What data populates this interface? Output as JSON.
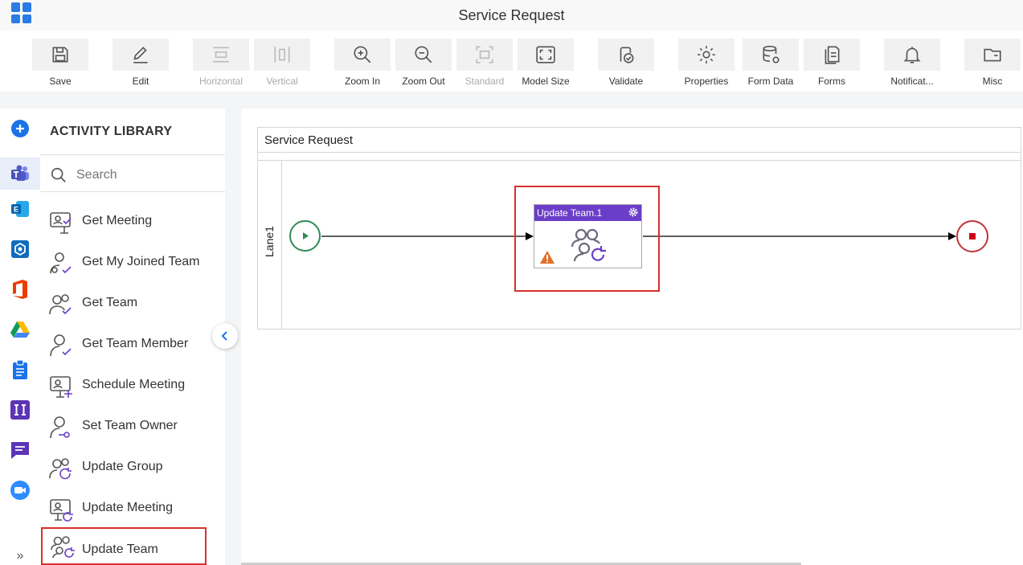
{
  "app": {
    "title": "Service Request"
  },
  "toolbar": {
    "items": [
      {
        "label": "Save",
        "icon": "save-icon",
        "enabled": true
      },
      {
        "label": "Edit",
        "icon": "edit-icon",
        "enabled": true
      },
      {
        "label": "Horizontal",
        "icon": "horizontal-icon",
        "enabled": false
      },
      {
        "label": "Vertical",
        "icon": "vertical-icon",
        "enabled": false
      },
      {
        "label": "Zoom In",
        "icon": "zoom-in-icon",
        "enabled": true
      },
      {
        "label": "Zoom Out",
        "icon": "zoom-out-icon",
        "enabled": true
      },
      {
        "label": "Standard",
        "icon": "standard-icon",
        "enabled": false
      },
      {
        "label": "Model Size",
        "icon": "model-size-icon",
        "enabled": true
      },
      {
        "label": "Validate",
        "icon": "validate-icon",
        "enabled": true
      },
      {
        "label": "Properties",
        "icon": "gear-icon",
        "enabled": true
      },
      {
        "label": "Form Data",
        "icon": "database-icon",
        "enabled": true
      },
      {
        "label": "Forms",
        "icon": "forms-icon",
        "enabled": true
      },
      {
        "label": "Notificat...",
        "icon": "bell-icon",
        "enabled": true
      },
      {
        "label": "Misc",
        "icon": "folder-icon",
        "enabled": true
      }
    ]
  },
  "rail": {
    "items": [
      "add-icon",
      "teams-icon",
      "exchange-icon",
      "box-icon",
      "office-icon",
      "drive-icon",
      "clipboard-icon",
      "ii-icon",
      "chat-icon",
      "zoom-icon"
    ]
  },
  "library": {
    "title": "ACTIVITY LIBRARY",
    "search_placeholder": "Search",
    "items": [
      {
        "label": "Get Meeting",
        "icon": "meeting-check-icon"
      },
      {
        "label": "Get My Joined Team",
        "icon": "user-team-check-icon"
      },
      {
        "label": "Get Team",
        "icon": "team-check-icon"
      },
      {
        "label": "Get Team Member",
        "icon": "user-check-icon"
      },
      {
        "label": "Schedule Meeting",
        "icon": "meeting-add-icon"
      },
      {
        "label": "Set Team Owner",
        "icon": "user-key-icon"
      },
      {
        "label": "Update Group",
        "icon": "group-refresh-icon"
      },
      {
        "label": "Update Meeting",
        "icon": "meeting-refresh-icon"
      },
      {
        "label": "Update Team",
        "icon": "team-refresh-icon",
        "selected": true
      }
    ]
  },
  "canvas": {
    "pool_title": "Service Request",
    "lane_label": "Lane1",
    "activity": {
      "title": "Update Team.1",
      "warning": true
    }
  },
  "colors": {
    "accent": "#6a3ec9",
    "highlight": "#d9302c",
    "start": "#2e8b57",
    "end": "#c0343b",
    "brand_blue": "#2a7be4"
  }
}
